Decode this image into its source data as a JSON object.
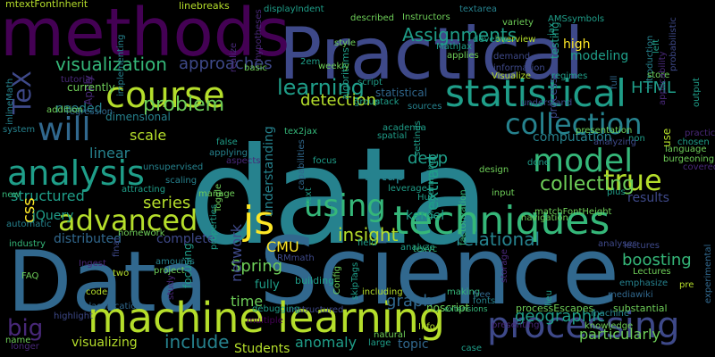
{
  "palette": {
    "background": "#000000",
    "purple": "#440154",
    "violet": "#482878",
    "indigo": "#3e4989",
    "blue": "#31688e",
    "teal_blue": "#26828e",
    "teal": "#1f9e89",
    "green": "#35b779",
    "lime": "#6ece58",
    "yellow_green": "#b5de2b",
    "yellow": "#fde725"
  },
  "words": [
    {
      "text": "data",
      "color": "teal_blue"
    },
    {
      "text": "Data",
      "color": "blue"
    },
    {
      "text": "Science",
      "color": "blue"
    },
    {
      "text": "Practical",
      "color": "indigo"
    },
    {
      "text": "methods",
      "color": "purple"
    },
    {
      "text": "machine learning",
      "color": "yellow_green"
    },
    {
      "text": "techniques",
      "color": "green"
    },
    {
      "text": "statistical",
      "color": "teal"
    },
    {
      "text": "processing",
      "color": "indigo"
    },
    {
      "text": "analysis",
      "color": "teal"
    },
    {
      "text": "course",
      "color": "yellow_green"
    },
    {
      "text": "model",
      "color": "green"
    },
    {
      "text": "collection",
      "color": "teal_blue"
    },
    {
      "text": "advanced",
      "color": "yellow_green"
    },
    {
      "text": "js",
      "color": "yellow"
    },
    {
      "text": "using",
      "color": "green"
    },
    {
      "text": "will",
      "color": "blue"
    },
    {
      "text": "true",
      "color": "yellow_green"
    },
    {
      "text": "big",
      "color": "violet"
    },
    {
      "text": "learning",
      "color": "teal"
    },
    {
      "text": "TeX",
      "color": "indigo"
    },
    {
      "text": "problem",
      "color": "lime"
    },
    {
      "text": "collecting",
      "color": "lime"
    },
    {
      "text": "visualization",
      "color": "green"
    },
    {
      "text": "insight",
      "color": "yellow_green"
    },
    {
      "text": "relational",
      "color": "teal_blue"
    },
    {
      "text": "series",
      "color": "yellow_green"
    },
    {
      "text": "approaches",
      "color": "indigo"
    },
    {
      "text": "statistical",
      "color": "blue"
    },
    {
      "text": "Assignments",
      "color": "teal"
    },
    {
      "text": "HTML",
      "color": "teal"
    },
    {
      "text": "detection",
      "color": "yellow_green"
    },
    {
      "text": "deep",
      "color": "teal"
    },
    {
      "text": "extract",
      "color": "teal"
    },
    {
      "text": "setup",
      "color": "teal_blue"
    },
    {
      "text": "graph",
      "color": "blue"
    },
    {
      "text": "boosting",
      "color": "green"
    },
    {
      "text": "geographic",
      "color": "teal"
    },
    {
      "text": "particularly",
      "color": "lime"
    },
    {
      "text": "include",
      "color": "teal_blue"
    },
    {
      "text": "visualizing",
      "color": "yellow_green"
    },
    {
      "text": "anomaly",
      "color": "teal"
    },
    {
      "text": "Spring",
      "color": "lime"
    },
    {
      "text": "CMU",
      "color": "yellow"
    },
    {
      "text": "network",
      "color": "indigo"
    },
    {
      "text": "time",
      "color": "lime"
    },
    {
      "text": "kernel",
      "color": "teal"
    },
    {
      "text": "modeling",
      "color": "teal"
    },
    {
      "text": "scale",
      "color": "yellow_green"
    },
    {
      "text": "linear",
      "color": "teal_blue"
    },
    {
      "text": "structured",
      "color": "teal"
    },
    {
      "text": "distributed",
      "color": "blue"
    },
    {
      "text": "complete",
      "color": "indigo"
    },
    {
      "text": "Students",
      "color": "yellow_green"
    },
    {
      "text": "topic",
      "color": "blue"
    },
    {
      "text": "high",
      "color": "yellow"
    },
    {
      "text": "testing",
      "color": "teal"
    },
    {
      "text": "results",
      "color": "indigo"
    },
    {
      "text": "computation",
      "color": "teal_blue"
    },
    {
      "text": "understanding",
      "color": "teal_blue"
    },
    {
      "text": "dimensional",
      "color": "teal_blue"
    },
    {
      "text": "needed",
      "color": "teal_blue"
    },
    {
      "text": "css",
      "color": "yellow"
    },
    {
      "text": "jQuery",
      "color": "teal"
    },
    {
      "text": "fully",
      "color": "teal"
    },
    {
      "text": "algorithms",
      "color": "teal"
    },
    {
      "text": "mtextFontInherit",
      "color": "yellow_green"
    },
    {
      "text": "linebreaks",
      "color": "yellow_green"
    },
    {
      "text": "displayIndent",
      "color": "teal"
    },
    {
      "text": "Apply",
      "color": "violet"
    },
    {
      "text": "currently",
      "color": "lime"
    },
    {
      "text": "processes",
      "color": "indigo"
    },
    {
      "text": "including",
      "color": "yellow_green"
    },
    {
      "text": "making",
      "color": "green"
    },
    {
      "text": "noscript",
      "color": "lime"
    },
    {
      "text": "processEscapes",
      "color": "lime"
    },
    {
      "text": "substantial",
      "color": "lime"
    },
    {
      "text": "focusing",
      "color": "teal"
    },
    {
      "text": "building",
      "color": "teal"
    },
    {
      "text": "unstructured",
      "color": "indigo"
    },
    {
      "text": "Config",
      "color": "lime"
    },
    {
      "text": "multiple",
      "color": "purple"
    },
    {
      "text": "natural",
      "color": "lime"
    },
    {
      "text": "extensions",
      "color": "green"
    },
    {
      "text": "emphasize",
      "color": "teal_blue"
    },
    {
      "text": "mediawiki",
      "color": "blue"
    },
    {
      "text": "machine",
      "color": "teal_blue"
    },
    {
      "text": "design",
      "color": "lime"
    },
    {
      "text": "jax",
      "color": "teal"
    },
    {
      "text": "weekly",
      "color": "lime"
    },
    {
      "text": "Hub",
      "color": "teal"
    },
    {
      "text": "Info",
      "color": "yellow_green"
    },
    {
      "text": "analyze",
      "color": "teal"
    },
    {
      "text": "industry",
      "color": "green"
    },
    {
      "text": "lectures",
      "color": "indigo"
    },
    {
      "text": "knowledge",
      "color": "lime"
    },
    {
      "text": "storage",
      "color": "violet"
    },
    {
      "text": "introduction",
      "color": "teal_blue"
    },
    {
      "text": "presentation",
      "color": "lime"
    },
    {
      "text": "demand",
      "color": "indigo"
    },
    {
      "text": "overview",
      "color": "yellow_green"
    },
    {
      "text": "develop",
      "color": "teal"
    },
    {
      "text": "MathJax",
      "color": "teal"
    },
    {
      "text": "applies",
      "color": "lime"
    },
    {
      "text": "factorization",
      "color": "green"
    },
    {
      "text": "programming",
      "color": "teal"
    },
    {
      "text": "settings",
      "color": "teal"
    },
    {
      "text": "sources",
      "color": "teal_blue"
    },
    {
      "text": "academia",
      "color": "teal"
    },
    {
      "text": "spatial",
      "color": "teal"
    },
    {
      "text": "focus",
      "color": "teal"
    },
    {
      "text": "stack",
      "color": "teal"
    },
    {
      "text": "tex2jax",
      "color": "green"
    },
    {
      "text": "leverage",
      "color": "teal"
    },
    {
      "text": "unsupervised",
      "color": "teal_blue"
    },
    {
      "text": "regression",
      "color": "blue"
    },
    {
      "text": "automatic",
      "color": "teal_blue"
    },
    {
      "text": "Toggle",
      "color": "lime"
    },
    {
      "text": "aspects",
      "color": "violet"
    },
    {
      "text": "scaling",
      "color": "teal_blue"
    },
    {
      "text": "applying",
      "color": "teal_blue"
    },
    {
      "text": "false",
      "color": "teal"
    },
    {
      "text": "manage",
      "color": "lime"
    },
    {
      "text": "attracting",
      "color": "teal"
    },
    {
      "text": "homework",
      "color": "lime"
    },
    {
      "text": "classification",
      "color": "blue"
    },
    {
      "text": "highlight",
      "color": "indigo"
    },
    {
      "text": "longer",
      "color": "violet"
    },
    {
      "text": "code",
      "color": "yellow_green"
    },
    {
      "text": "project",
      "color": "lime"
    },
    {
      "text": "amounts",
      "color": "teal_blue"
    },
    {
      "text": "properties",
      "color": "teal"
    },
    {
      "text": "study",
      "color": "violet"
    },
    {
      "text": "final",
      "color": "indigo"
    },
    {
      "text": "Ingest",
      "color": "violet"
    },
    {
      "text": "two",
      "color": "yellow_green"
    },
    {
      "text": "FAQ",
      "color": "lime"
    },
    {
      "text": "name",
      "color": "lime"
    },
    {
      "text": "new",
      "color": "green"
    },
    {
      "text": "system",
      "color": "teal_blue"
    },
    {
      "text": "inlineMath",
      "color": "teal_blue"
    },
    {
      "text": "addition",
      "color": "lime"
    },
    {
      "text": "tutorial",
      "color": "violet"
    },
    {
      "text": "implementing",
      "color": "teal_blue"
    },
    {
      "text": "hypotheses",
      "color": "violet"
    },
    {
      "text": "realize",
      "color": "violet"
    },
    {
      "text": "basic",
      "color": "lime"
    },
    {
      "text": "2em",
      "color": "teal"
    },
    {
      "text": "style",
      "color": "lime"
    },
    {
      "text": "script",
      "color": "teal"
    },
    {
      "text": "described",
      "color": "lime"
    },
    {
      "text": "group",
      "color": "teal"
    },
    {
      "text": "Instructors",
      "color": "lime"
    },
    {
      "text": "textarea",
      "color": "teal_blue"
    },
    {
      "text": "variety",
      "color": "lime"
    },
    {
      "text": "AMSsymbols",
      "color": "teal"
    },
    {
      "text": "information",
      "color": "indigo"
    },
    {
      "text": "Visualize",
      "color": "yellow_green"
    },
    {
      "text": "regimes",
      "color": "teal"
    },
    {
      "text": "understand",
      "color": "indigo"
    },
    {
      "text": "full",
      "color": "blue"
    },
    {
      "text": "store",
      "color": "lime"
    },
    {
      "text": "left",
      "color": "teal"
    },
    {
      "text": "applicability",
      "color": "violet"
    },
    {
      "text": "probabilistic",
      "color": "indigo"
    },
    {
      "text": "output",
      "color": "teal"
    },
    {
      "text": "practice",
      "color": "violet"
    },
    {
      "text": "chosen",
      "color": "teal"
    },
    {
      "text": "language",
      "color": "lime"
    },
    {
      "text": "burgeoning",
      "color": "lime"
    },
    {
      "text": "covered",
      "color": "violet"
    },
    {
      "text": "experimental",
      "color": "blue"
    },
    {
      "text": "use",
      "color": "yellow_green"
    },
    {
      "text": "non",
      "color": "teal"
    },
    {
      "text": "done",
      "color": "teal"
    },
    {
      "text": "analyzing",
      "color": "indigo"
    },
    {
      "text": "matchFontHeight",
      "color": "lime"
    },
    {
      "text": "navigation",
      "color": "lime"
    },
    {
      "text": "plus",
      "color": "teal"
    },
    {
      "text": "analyses",
      "color": "indigo"
    },
    {
      "text": "lieu",
      "color": "teal"
    },
    {
      "text": "fonts",
      "color": "teal_blue"
    },
    {
      "text": "free",
      "color": "blue"
    },
    {
      "text": "presenting",
      "color": "violet"
    },
    {
      "text": "case",
      "color": "teal"
    },
    {
      "text": "large",
      "color": "teal"
    },
    {
      "text": "skipTags",
      "color": "teal"
    },
    {
      "text": "field",
      "color": "teal"
    },
    {
      "text": "texvc",
      "color": "green"
    },
    {
      "text": "input",
      "color": "lime"
    },
    {
      "text": "capabilities",
      "color": "blue"
    },
    {
      "text": "text",
      "color": "teal"
    },
    {
      "text": "debugging",
      "color": "teal"
    },
    {
      "text": "RMmath",
      "color": "indigo"
    },
    {
      "text": "pre",
      "color": "yellow_green"
    },
    {
      "text": "Lectures",
      "color": "lime"
    }
  ]
}
